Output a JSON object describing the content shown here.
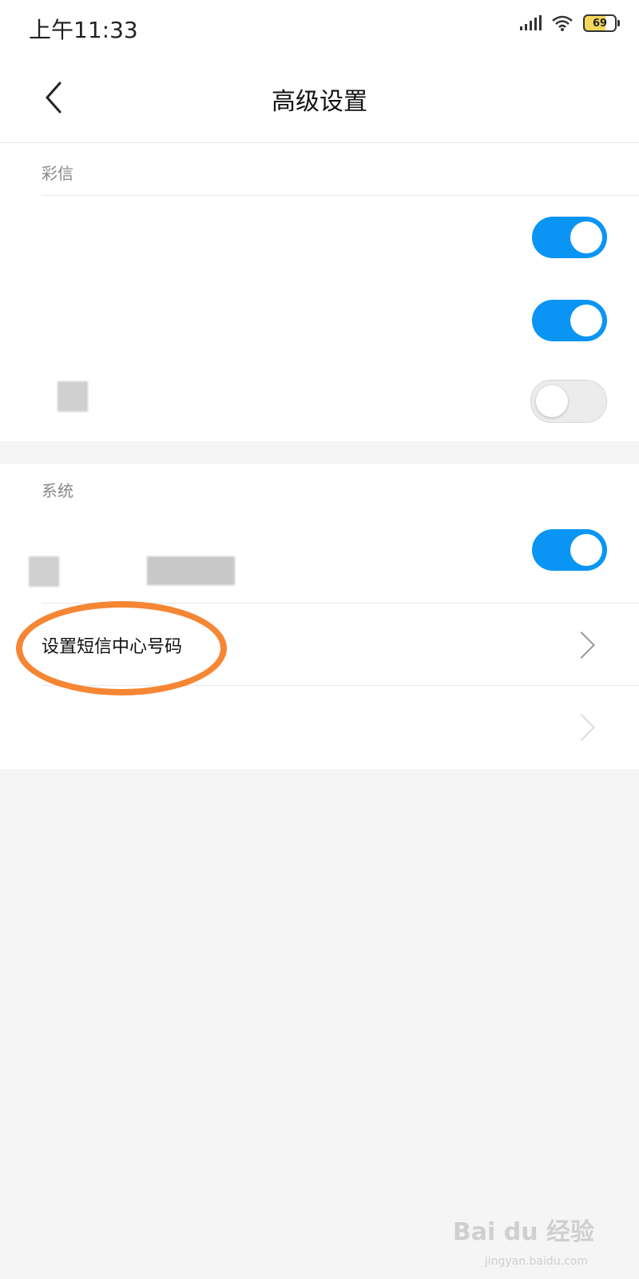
{
  "status_bar": {
    "time": "上午11:33",
    "battery_percent": "69",
    "signal_icon": "signal-icon",
    "wifi_icon": "wifi-icon"
  },
  "header": {
    "title": "高级设置",
    "back_icon": "back-chevron-icon"
  },
  "mms_section": {
    "header": "彩信",
    "toggles": [
      true,
      true,
      false
    ]
  },
  "system_section": {
    "header": "系统",
    "toggle": true,
    "sms_center_label": "设置短信中心号码"
  },
  "watermark": {
    "text": "Bai du 经验",
    "sub": "jingyan.baidu.com"
  },
  "colors": {
    "accent": "#0a95f5",
    "highlight": "#f58634"
  }
}
